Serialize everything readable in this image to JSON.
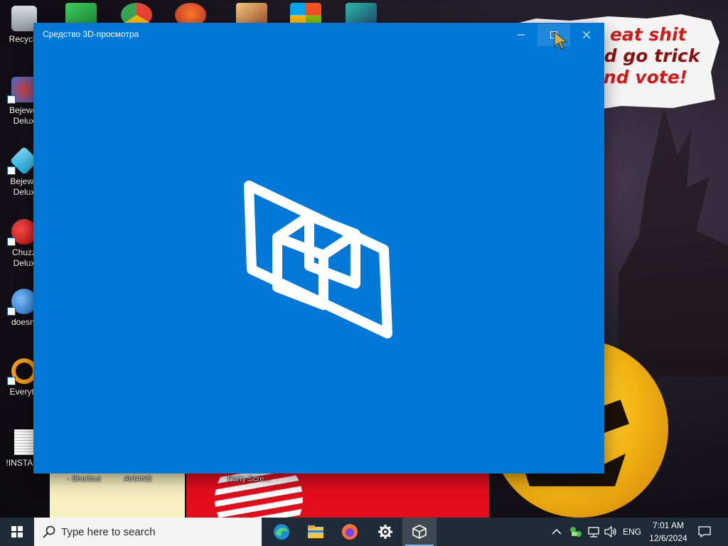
{
  "window": {
    "title": "Средство 3D-просмотра",
    "accent": "#0078d7"
  },
  "desktop": {
    "icons": [
      {
        "label": "Recycle",
        "icon": "recycle-bin-icon"
      },
      {
        "label": "Bejewel",
        "label2": "Delux",
        "icon": "bejeweled-icon"
      },
      {
        "label": "Bejewe",
        "label2": "Delux",
        "icon": "bejeweled-2-icon"
      },
      {
        "label": "Chuzz",
        "label2": "Delux",
        "icon": "chuzzle-icon"
      },
      {
        "label": "doesnt",
        "icon": "globe-app-icon"
      },
      {
        "label": "Everyth",
        "icon": "everything-search-icon"
      },
      {
        "label": "!INSTALL",
        "icon": "text-file-icon"
      }
    ],
    "bottom_labels": [
      "- Shortcut",
      "AVIANS",
      "Party Scre..."
    ]
  },
  "wallpaper": {
    "note_lines": [
      "o eat shit",
      "nd go trick",
      "and vote!"
    ]
  },
  "taskbar": {
    "search_placeholder": "Type here to search",
    "apps": [
      "edge-icon",
      "file-explorer-icon",
      "firefox-icon",
      "settings-icon",
      "3d-viewer-icon"
    ],
    "language": "ENG",
    "time": "7:01 AM",
    "date": "12/6/2024"
  }
}
